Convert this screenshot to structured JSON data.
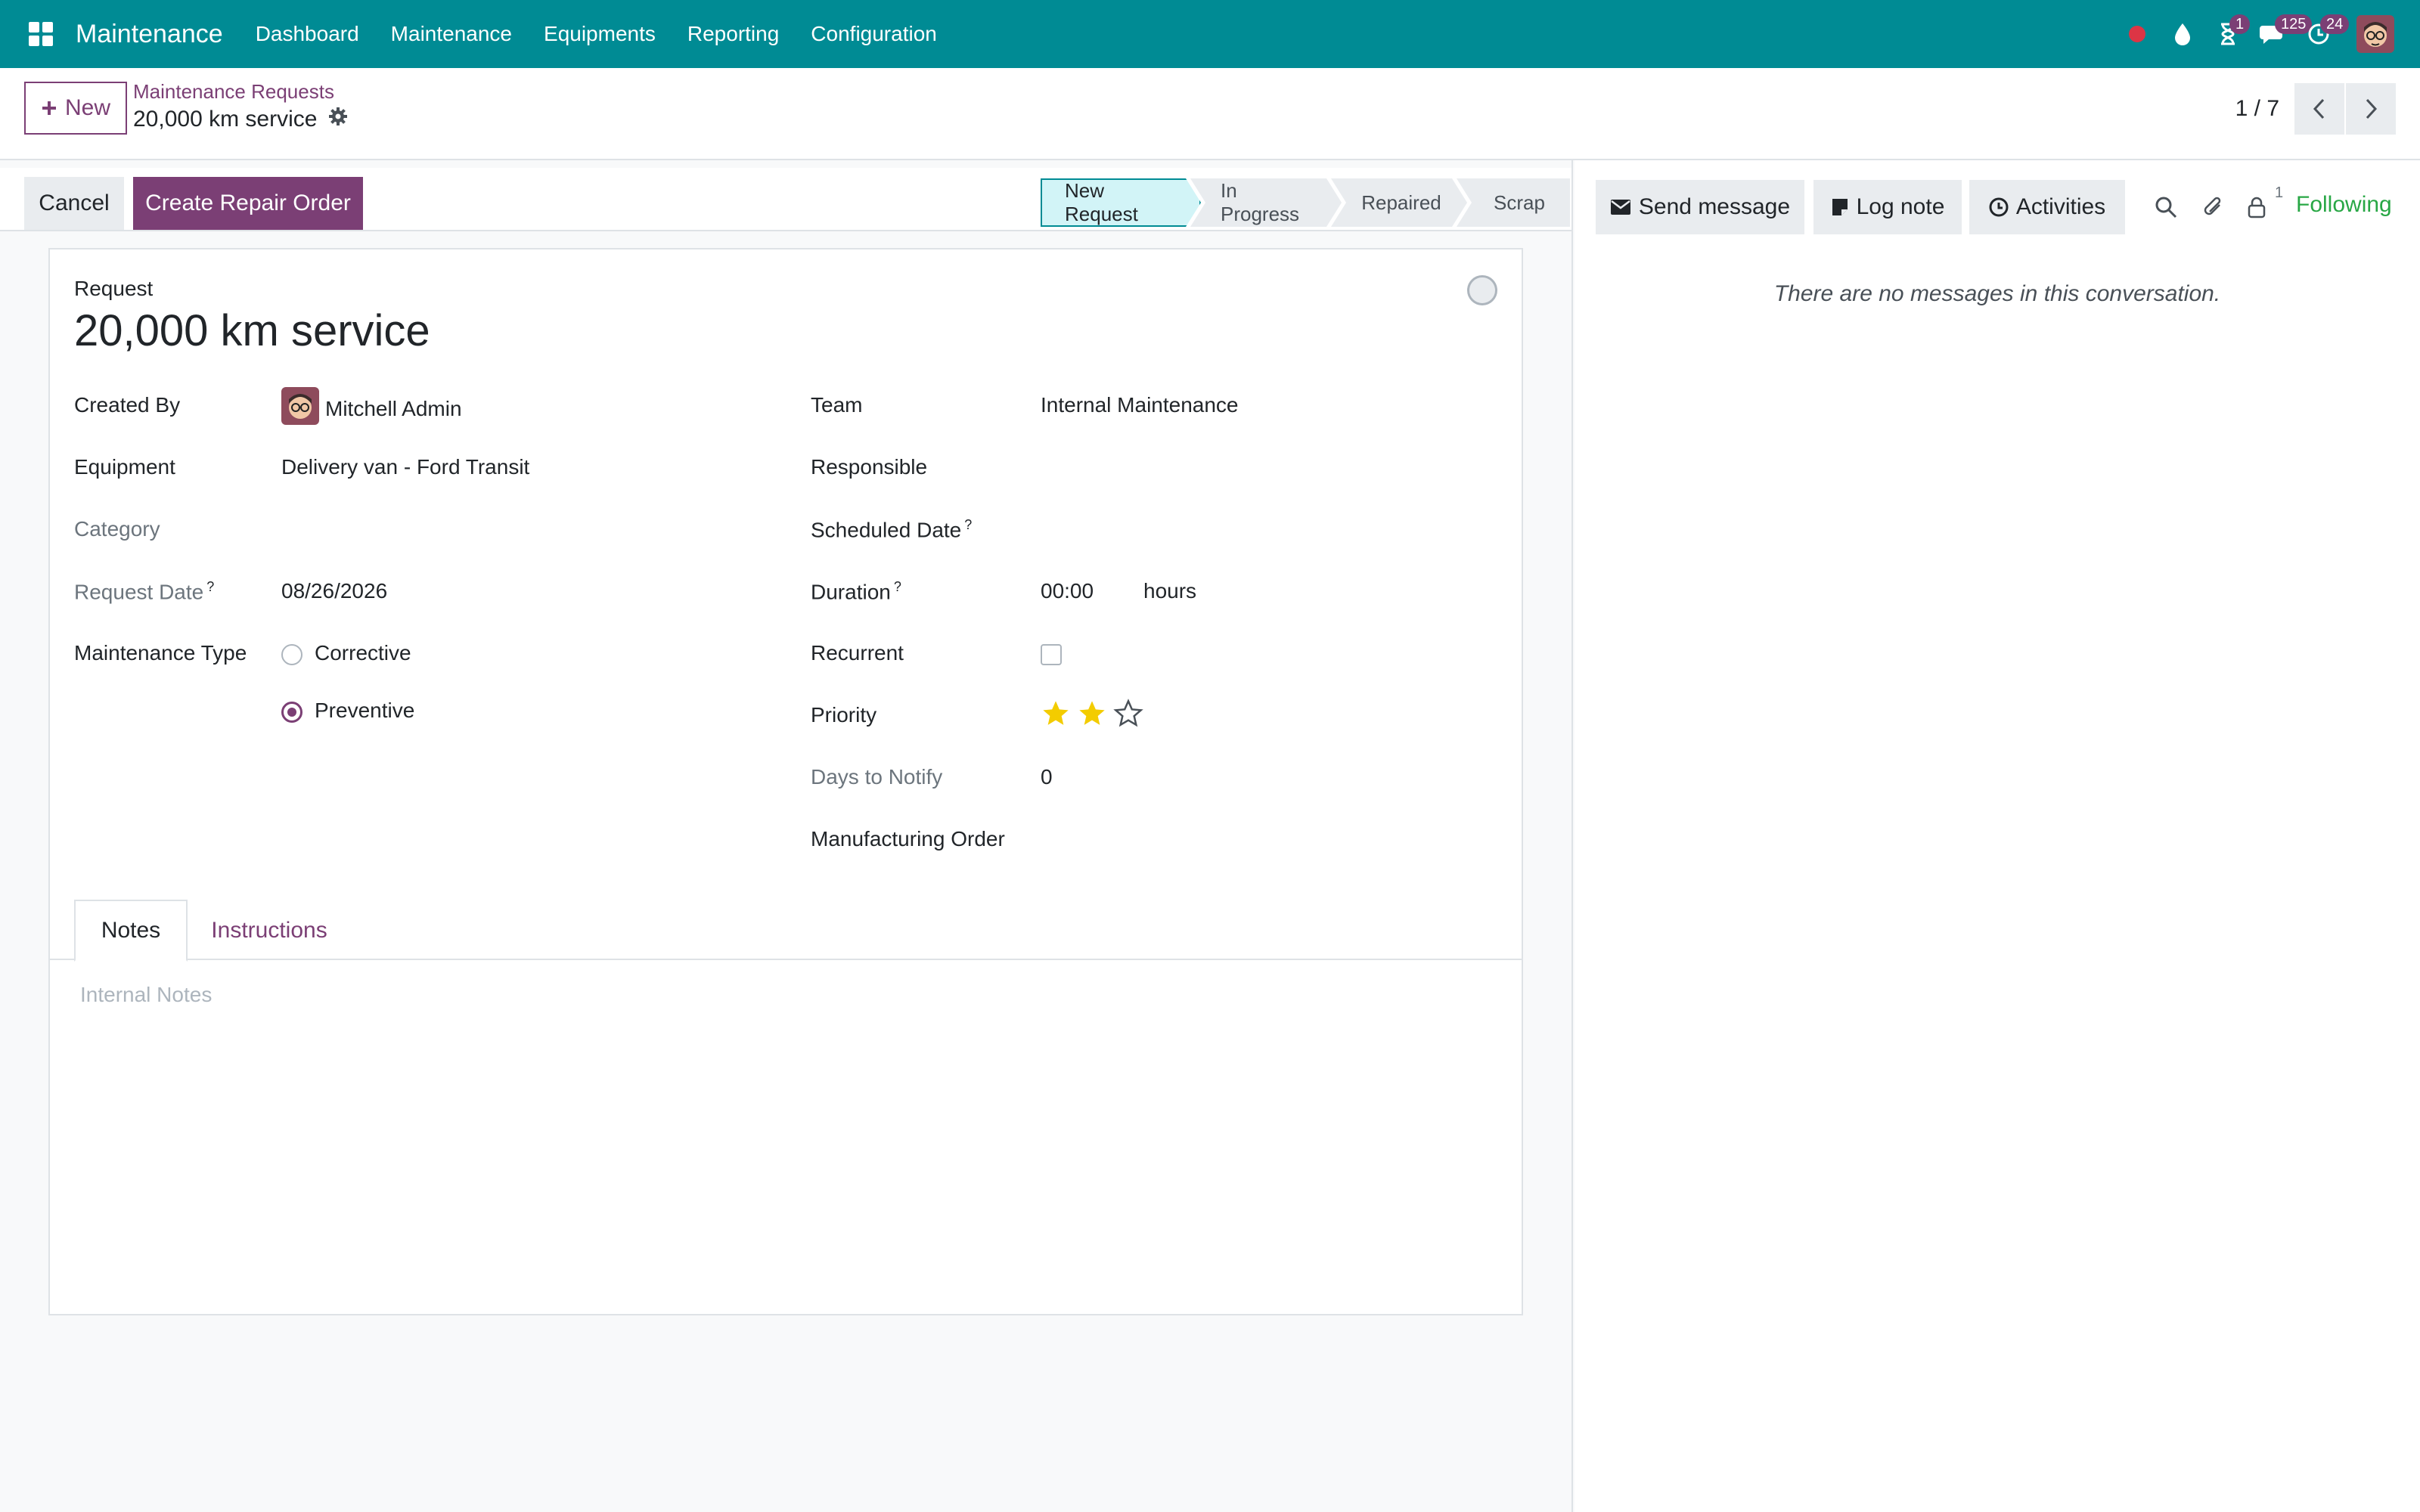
{
  "navbar": {
    "app_name": "Maintenance",
    "menu": [
      "Dashboard",
      "Maintenance",
      "Equipments",
      "Reporting",
      "Configuration"
    ],
    "badges": {
      "activities": "1",
      "messages": "125",
      "clock": "24"
    },
    "colors": {
      "bar": "#008b94",
      "badge": "#7b3f75",
      "record": "#dc3545"
    }
  },
  "control_panel": {
    "new_label": "New",
    "breadcrumb_parent": "Maintenance Requests",
    "breadcrumb_current": "20,000 km service",
    "pager": "1 / 7"
  },
  "statusbar": {
    "cancel_label": "Cancel",
    "repair_label": "Create Repair Order",
    "stages": [
      "New Request",
      "In Progress",
      "Repaired",
      "Scrap"
    ],
    "active_stage": "New Request"
  },
  "form": {
    "request_label": "Request",
    "title": "20,000 km service",
    "left": {
      "created_by_label": "Created By",
      "created_by_value": "Mitchell Admin",
      "equipment_label": "Equipment",
      "equipment_value": "Delivery van - Ford Transit",
      "category_label": "Category",
      "request_date_label": "Request Date",
      "request_date_value": "08/26/2026",
      "maintenance_type_label": "Maintenance Type",
      "maintenance_type_options": [
        "Corrective",
        "Preventive"
      ],
      "maintenance_type_selected": "Preventive"
    },
    "right": {
      "team_label": "Team",
      "team_value": "Internal Maintenance",
      "responsible_label": "Responsible",
      "scheduled_date_label": "Scheduled Date",
      "duration_label": "Duration",
      "duration_value": "00:00",
      "duration_unit": "hours",
      "recurrent_label": "Recurrent",
      "recurrent_checked": false,
      "priority_label": "Priority",
      "priority_stars": 2,
      "priority_max": 3,
      "days_to_notify_label": "Days to Notify",
      "days_to_notify_value": "0",
      "manufacturing_order_label": "Manufacturing Order"
    },
    "help_mark": "?",
    "tabs": [
      "Notes",
      "Instructions"
    ],
    "notes_placeholder": "Internal Notes"
  },
  "chatter": {
    "send_message_label": "Send message",
    "log_note_label": "Log note",
    "activities_label": "Activities",
    "follower_count": "1",
    "following_label": "Following",
    "empty_text": "There are no messages in this conversation."
  }
}
